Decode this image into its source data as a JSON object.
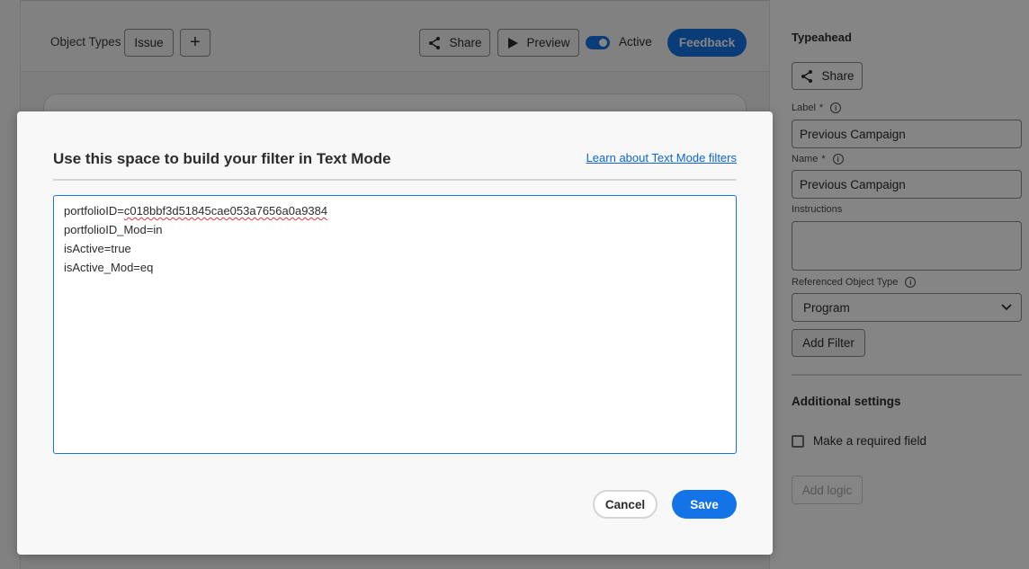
{
  "header": {
    "object_types_label": "Object Types",
    "issue_button": "Issue",
    "add_button": "+",
    "share_button": "Share",
    "preview_button": "Preview",
    "active_label": "Active",
    "active_toggle_on": true,
    "feedback_button": "Feedback"
  },
  "right_panel": {
    "title": "Typeahead",
    "share_button": "Share",
    "label_field": {
      "label": "Label",
      "required_mark": "*",
      "value": "Previous Campaign"
    },
    "name_field": {
      "label": "Name",
      "required_mark": "*",
      "value": "Previous Campaign"
    },
    "instructions_field": {
      "label": "Instructions",
      "value": ""
    },
    "referenced_object_type": {
      "label": "Referenced Object Type",
      "value": "Program"
    },
    "add_filter_button": "Add Filter",
    "additional_settings_title": "Additional settings",
    "required_field_checkbox": {
      "label": "Make a required field",
      "checked": false
    },
    "add_logic_button": "Add logic"
  },
  "modal": {
    "title": "Use this space to build your filter in Text Mode",
    "learn_link": "Learn about Text Mode filters",
    "filter_lines": [
      "portfolioID=c018bbf3d51845cae053a7656a0a9384",
      "portfolioID_Mod=in",
      "isActive=true",
      "isActive_Mod=eq"
    ],
    "cancel_button": "Cancel",
    "save_button": "Save"
  },
  "colors": {
    "accent": "#1473e6",
    "link": "#0d66d0",
    "overlay": "rgba(0,0,0,0.48)"
  }
}
